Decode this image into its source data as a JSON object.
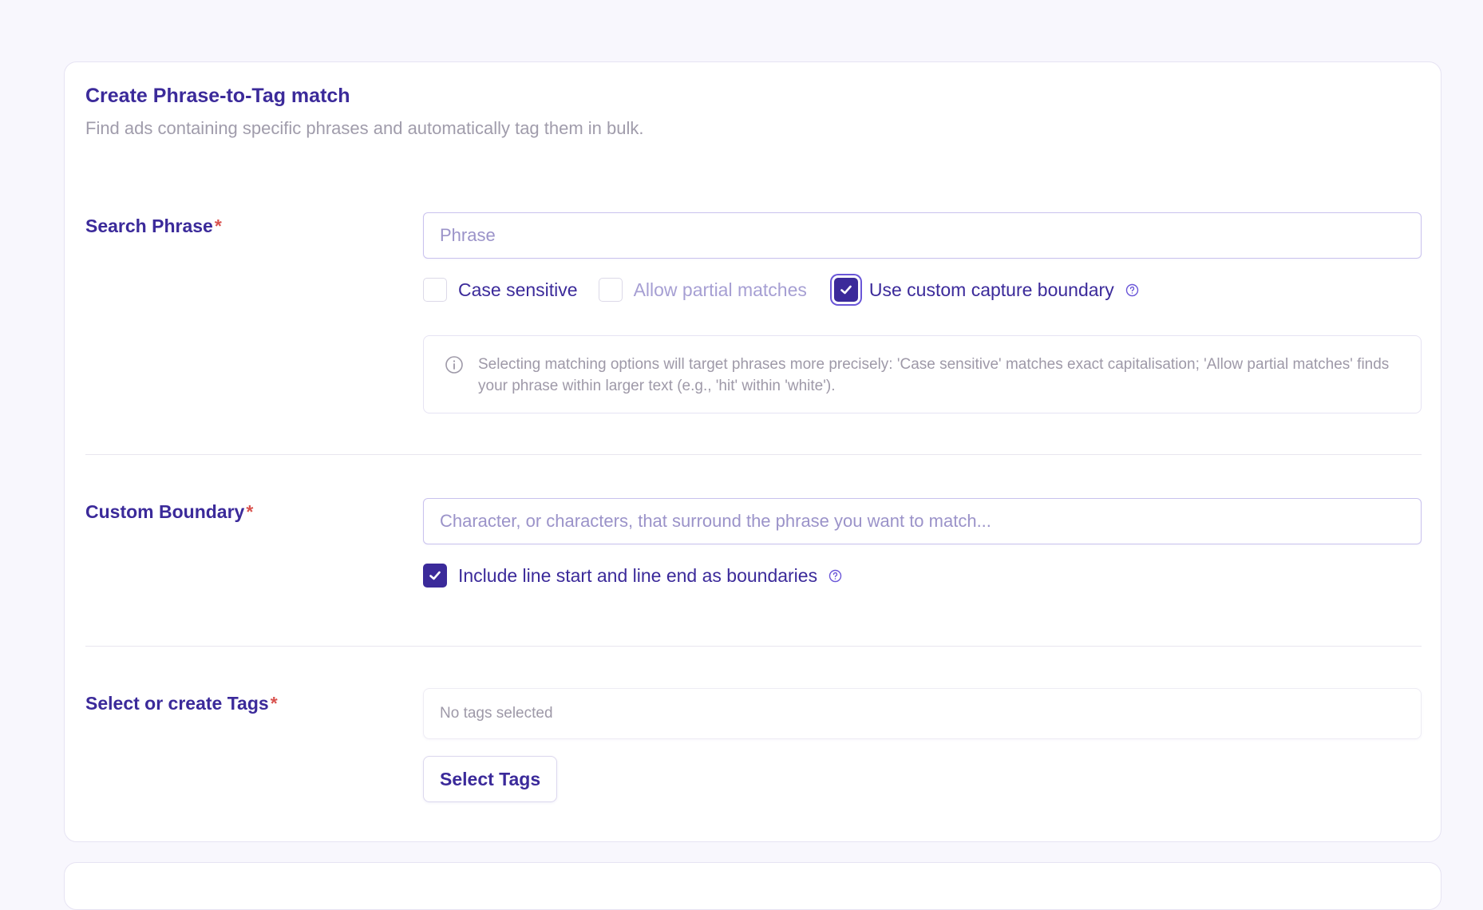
{
  "header": {
    "title": "Create Phrase-to-Tag match",
    "subtitle": "Find ads containing specific phrases and automatically tag them in bulk."
  },
  "search_phrase": {
    "label": "Search Phrase",
    "required_mark": "*",
    "placeholder": "Phrase",
    "value": "",
    "options": [
      {
        "label": "Case sensitive",
        "checked": false,
        "disabled": false
      },
      {
        "label": "Allow partial matches",
        "checked": false,
        "disabled": true
      },
      {
        "label": "Use custom capture boundary",
        "checked": true,
        "disabled": false,
        "has_help": true
      }
    ],
    "info_text": "Selecting matching options will target phrases more precisely: 'Case sensitive' matches exact capitalisation; 'Allow partial matches' finds your phrase within larger text (e.g., 'hit' within 'white')."
  },
  "custom_boundary": {
    "label": "Custom Boundary",
    "required_mark": "*",
    "placeholder": "Character, or characters, that surround the phrase you want to match...",
    "value": "",
    "option": {
      "label": "Include line start and line end as boundaries",
      "checked": true,
      "has_help": true
    }
  },
  "tags": {
    "label": "Select or create Tags",
    "required_mark": "*",
    "empty_text": "No tags selected",
    "button_label": "Select Tags"
  },
  "colors": {
    "primary": "#3b2a9a",
    "required": "#d9534f",
    "muted": "#9e99a8",
    "background": "#f8f7fd"
  },
  "icons": {
    "help": "question-circle-icon",
    "info": "info-circle-icon",
    "check": "checkmark-icon"
  }
}
